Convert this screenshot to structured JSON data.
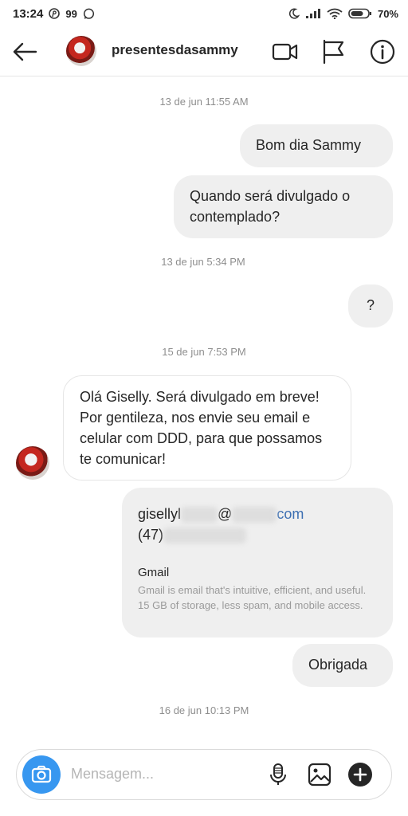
{
  "status_bar": {
    "time": "13:24",
    "count": "99",
    "battery": "70%"
  },
  "header": {
    "username": "presentesdasammy"
  },
  "messages": {
    "ts1": "13 de jun 11:55 AM",
    "out1": "Bom dia Sammy",
    "out2": "Quando será divulgado o contemplado?",
    "ts2": "13 de jun 5:34 PM",
    "out3": "?",
    "ts3": "15 de jun 7:53 PM",
    "in1": "Olá Giselly. Será divulgado em breve! Por gentileza, nos envie seu email e celular com DDD, para que possamos te comunicar!",
    "email_prefix": "gisellyl",
    "email_at": "@",
    "email_suffix": "com",
    "phone_prefix": "(47)",
    "card_title": "Gmail",
    "card_desc": "Gmail is email that's intuitive, efficient, and useful. 15 GB of storage, less spam, and mobile access.",
    "out4": "Obrigada",
    "ts4": "16 de jun 10:13 PM"
  },
  "composer": {
    "placeholder": "Mensagem..."
  }
}
